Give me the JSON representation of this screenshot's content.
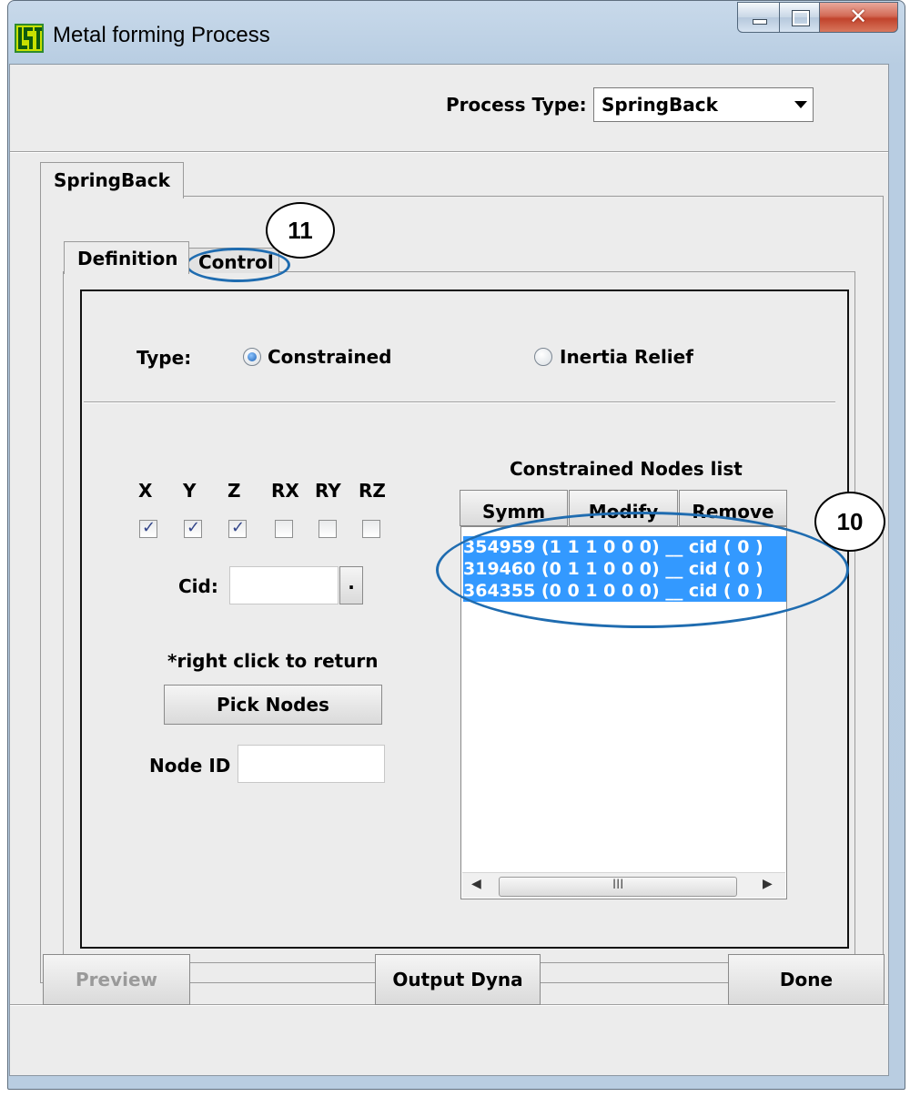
{
  "window": {
    "title": "Metal forming Process",
    "colors": {
      "title_bar": "#b9cde1",
      "client": "#ececec",
      "selection": "#3399ff",
      "callout": "#1f6cb0"
    }
  },
  "process": {
    "label": "Process Type:",
    "value": "SpringBack"
  },
  "outer_tab": {
    "label": "SpringBack"
  },
  "inner_tabs": [
    {
      "label": "Definition",
      "selected": true
    },
    {
      "label": "Control",
      "selected": false
    }
  ],
  "type_row": {
    "label": "Type:",
    "options": [
      {
        "label": "Constrained",
        "selected": true
      },
      {
        "label": "Inertia Relief",
        "selected": false
      }
    ]
  },
  "dof": {
    "labels": [
      "X",
      "Y",
      "Z",
      "RX",
      "RY",
      "RZ"
    ],
    "checked": [
      true,
      true,
      true,
      false,
      false,
      false
    ]
  },
  "cid": {
    "label": "Cid:",
    "value": "",
    "button": "."
  },
  "hint": "*right click to return",
  "pick_nodes_label": "Pick Nodes",
  "node_id": {
    "label": "Node ID",
    "value": ""
  },
  "nodes_list": {
    "title": "Constrained Nodes list",
    "buttons": [
      "Symm",
      "Modify",
      "Remove"
    ],
    "items": [
      "354959 (1 1 1 0 0 0) __ cid ( 0 )",
      "319460 (0 1 1 0 0 0) __ cid ( 0 )",
      "364355 (0 0 1 0 0 0) __ cid ( 0 )"
    ],
    "scroll_grip": "III"
  },
  "footer": {
    "preview": "Preview",
    "output": "Output Dyna",
    "done": "Done"
  },
  "callouts": {
    "a": "11",
    "b": "10"
  }
}
